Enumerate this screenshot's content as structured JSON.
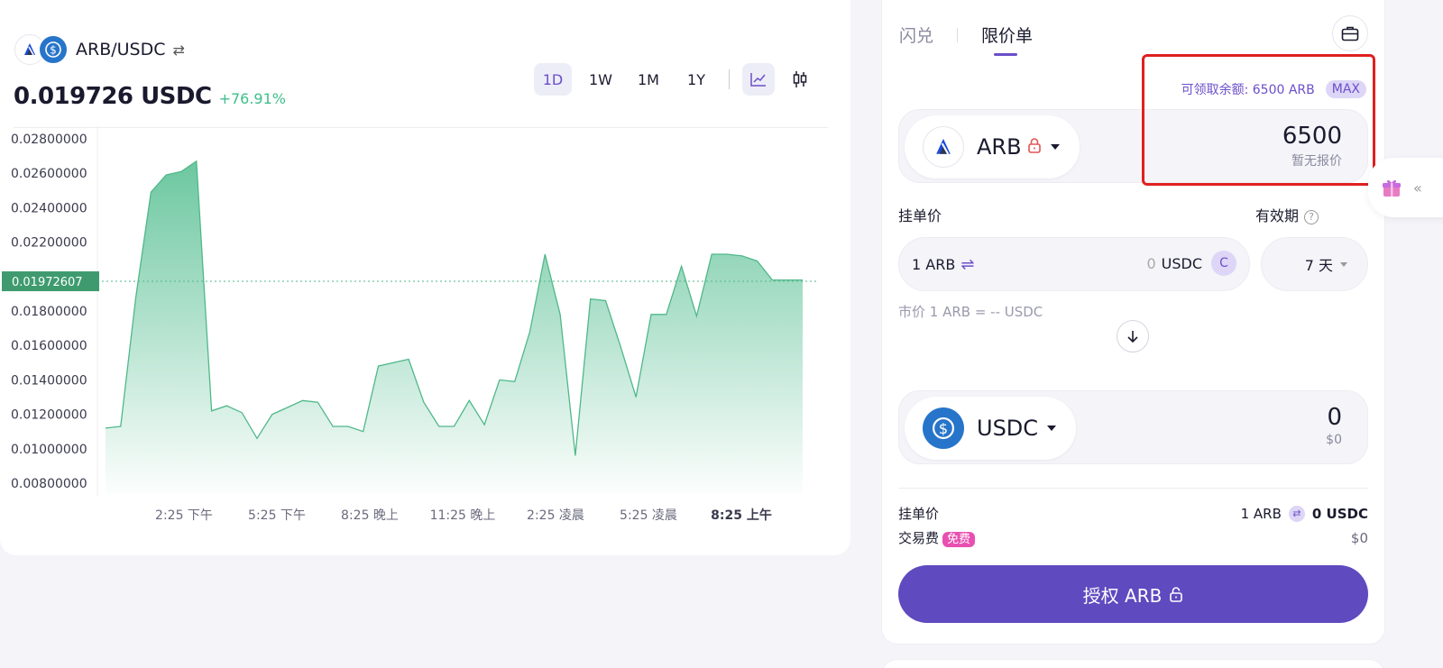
{
  "pair": {
    "name": "ARB/USDC",
    "base_icon": "arbitrum-icon",
    "quote_icon": "usdc-icon"
  },
  "price": {
    "value": "0.019726 USDC",
    "change": "+76.91%"
  },
  "ranges": [
    "1D",
    "1W",
    "1M",
    "1Y"
  ],
  "active_range": "1D",
  "chart_data": {
    "type": "area",
    "y_ticks": [
      "0.02800000",
      "0.02600000",
      "0.02400000",
      "0.02200000",
      "0.01800000",
      "0.01600000",
      "0.01400000",
      "0.01200000",
      "0.01000000",
      "0.00800000"
    ],
    "x_ticks": [
      "2:25 下午",
      "5:25 下午",
      "8:25 晚上",
      "11:25 晚上",
      "2:25 凌晨",
      "5:25 凌晨",
      "8:25 上午"
    ],
    "current_label": "0.01972607",
    "current_value": 0.01972607,
    "ylim": [
      0.0078,
      0.0288
    ],
    "values": [
      0.0112,
      0.0113,
      0.0188,
      0.0249,
      0.0259,
      0.0261,
      0.0267,
      0.0122,
      0.0125,
      0.0121,
      0.0106,
      0.012,
      0.0124,
      0.0128,
      0.0127,
      0.0113,
      0.0113,
      0.011,
      0.0148,
      0.015,
      0.0152,
      0.0127,
      0.0113,
      0.0113,
      0.0128,
      0.0114,
      0.014,
      0.0139,
      0.0168,
      0.0213,
      0.0178,
      0.0096,
      0.0187,
      0.0186,
      0.0159,
      0.013,
      0.0178,
      0.0178,
      0.0206,
      0.0177,
      0.0213,
      0.0213,
      0.0212,
      0.0209,
      0.0198,
      0.0198,
      0.0198
    ]
  },
  "trade": {
    "tabs": [
      "闪兑",
      "限价单"
    ],
    "active_tab": "限价单",
    "balance_label": "可领取余额: 6500 ARB",
    "max_label": "MAX",
    "from": {
      "token": "ARB",
      "amount": "6500",
      "sub": "暂无报价"
    },
    "to": {
      "token": "USDC",
      "amount": "0",
      "sub": "$0"
    },
    "limit_price_label": "挂单价",
    "expiry_label": "有效期",
    "expiry_help": "?",
    "price_base": "1 ARB",
    "price_zero": "0",
    "price_unit": "USDC",
    "c_label": "C",
    "expiry_value": "7 天",
    "market_text": "市价 1 ARB = -- USDC",
    "summary_price_label": "挂单价",
    "summary_base": "1 ARB",
    "summary_quote": "0 USDC",
    "fee_label": "交易费",
    "fee_badge": "免费",
    "fee_value": "$0",
    "approve_label": "授权 ARB"
  },
  "colors": {
    "accent": "#6b4fc9",
    "green": "#3dbf8a",
    "approve": "#5f4abf",
    "highlight": "#e02020"
  }
}
